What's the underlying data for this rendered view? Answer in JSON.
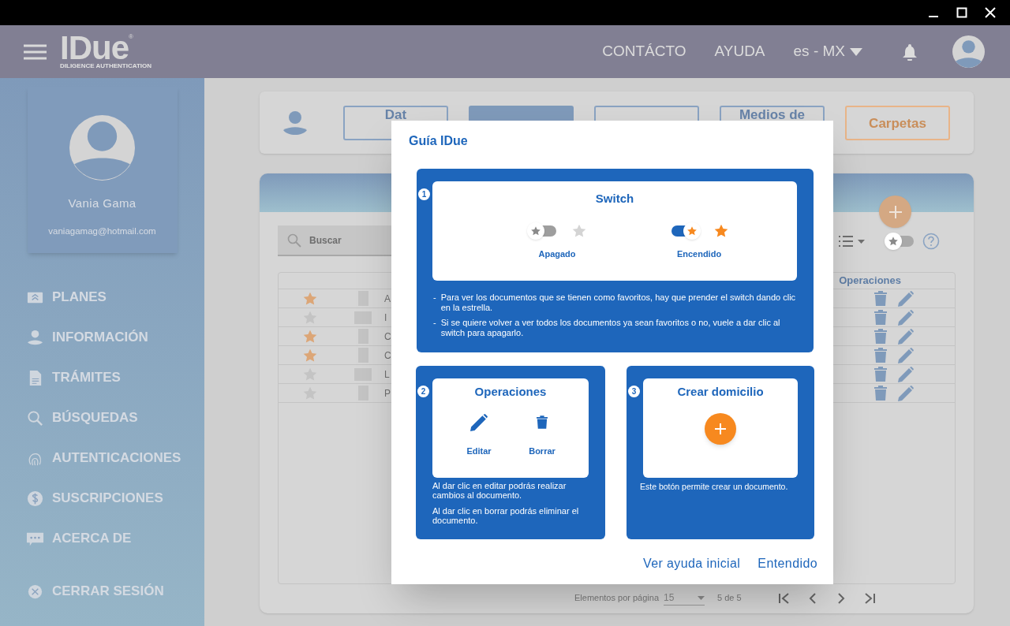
{
  "top_bar": {
    "logo": "IDue",
    "logo_mark": "®",
    "logo_subtitle": "DILIGENCE AUTHENTICATION",
    "links": [
      "CONTÁCTO",
      "AYUDA"
    ],
    "language": "es - MX"
  },
  "profile": {
    "name": "Vania Gama",
    "email": "vaniagamag@hotmail.com"
  },
  "sidebar": {
    "items": [
      "PLANES",
      "INFORMACIÓN",
      "TRÁMITES",
      "BÚSQUEDAS",
      "AUTENTICACIONES",
      "SUSCRIPCIONES",
      "ACERCA DE"
    ],
    "logout": "CERRAR SESIÓN"
  },
  "tabs": [
    {
      "label": "Dat",
      "selected": false,
      "kind": "plain"
    },
    {
      "selected": true,
      "kind": "plain"
    },
    {
      "selected": false,
      "kind": "plain"
    },
    {
      "label": "Medios de",
      "selected": false,
      "kind": "plain"
    },
    {
      "label": "Carpetas",
      "selected": false,
      "kind": "accent"
    }
  ],
  "search": {
    "placeholder": "Buscar"
  },
  "favorites_switch": {
    "on": false
  },
  "table": {
    "operations_header": "Operaciones",
    "rows": [
      {
        "favorite": true,
        "wide_thumbnail": false,
        "column_3": "A"
      },
      {
        "favorite": false,
        "wide_thumbnail": true,
        "column_3": "I"
      },
      {
        "favorite": true,
        "wide_thumbnail": false,
        "column_3": "C"
      },
      {
        "favorite": true,
        "wide_thumbnail": false,
        "column_3": "C"
      },
      {
        "favorite": false,
        "wide_thumbnail": true,
        "column_3": "L"
      },
      {
        "favorite": false,
        "wide_thumbnail": false,
        "column_3": "P"
      }
    ]
  },
  "pagination": {
    "label": "Elementos por página",
    "page_size": "15",
    "range": "5 de 5"
  },
  "guide": {
    "title": "Guía IDue",
    "switch_section": {
      "number": "1",
      "title": "Switch",
      "examples": [
        {
          "label": "Apagado",
          "on": false
        },
        {
          "label": "Encendido",
          "on": true
        }
      ],
      "notes": [
        {
          "marker": "-",
          "text": "Para ver los documentos que se tienen como favoritos, hay que prender el switch dando clic en la estrella."
        },
        {
          "marker": "-",
          "text": "Si se quiere volver a ver todos los documentos ya sean favoritos o no, vuele a dar clic al switch para apagarlo."
        }
      ]
    },
    "operations_section": {
      "number": "2",
      "title": "Operaciones",
      "actions": [
        {
          "label": "Editar",
          "kind": "edit"
        },
        {
          "label": "Borrar",
          "kind": "delete"
        }
      ],
      "paragraphs": [
        "Al dar clic en editar podrás realizar cambios al documento.",
        "Al dar clic en borrar podrás eliminar el documento."
      ]
    },
    "create_section": {
      "number": "3",
      "title": "Crear domicilio",
      "description": "Este botón permite crear un documento."
    },
    "buttons": [
      "Ver ayuda inicial",
      "Entendido"
    ]
  }
}
